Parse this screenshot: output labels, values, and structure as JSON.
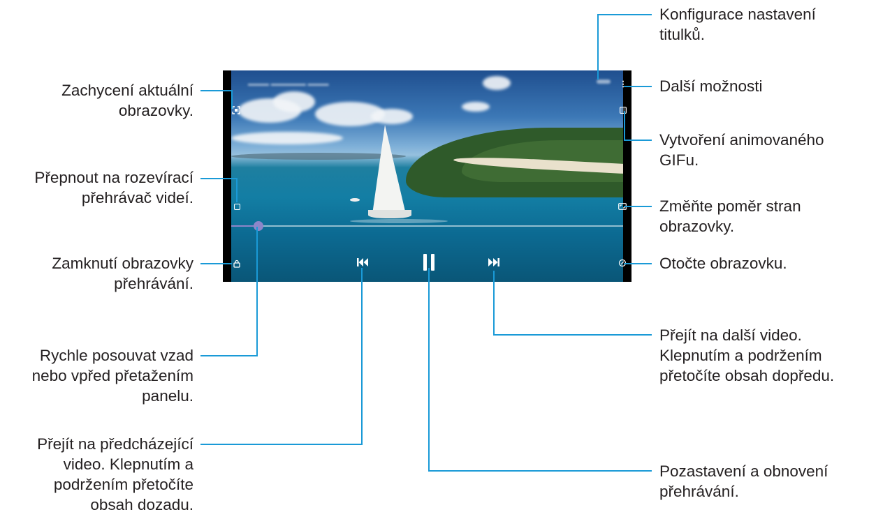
{
  "labels": {
    "subtitle_settings": [
      "Konfigurace nastavení",
      "titulků."
    ],
    "more_options": "Další možnosti",
    "create_gif": [
      "Vytvoření animovaného",
      "GIFu."
    ],
    "aspect_ratio": [
      "Změňte poměr stran",
      "obrazovky."
    ],
    "rotate": "Otočte obrazovku.",
    "next_video": [
      "Přejít na další video.",
      "Klepnutím a podržením",
      "přetočíte obsah dopředu."
    ],
    "pause_resume": [
      "Pozastavení a obnovení",
      "přehrávání."
    ],
    "capture": [
      "Zachycení aktuální",
      "obrazovky."
    ],
    "popup_player": [
      "Přepnout na rozevírací",
      "přehrávač videí."
    ],
    "lock": [
      "Zamknutí obrazovky",
      "přehrávání."
    ],
    "seek": [
      "Rychle posouvat vzad",
      "nebo vpřed přetažením",
      "panelu."
    ],
    "prev_video": [
      "Přejít na předcházející",
      "video. Klepnutím a",
      "podržením přetočíte",
      "obsah dozadu."
    ]
  },
  "player": {
    "progress": 0.07,
    "icons": {
      "capture": "capture-icon",
      "popup": "popup-player-icon",
      "lock": "lock-icon",
      "more": "more-options-icon",
      "gif": "gif-icon",
      "aspect": "aspect-ratio-icon",
      "rotate": "rotate-icon",
      "prev": "previous-icon",
      "pause": "pause-icon",
      "next": "next-icon"
    }
  },
  "colors": {
    "callout_line": "#1a9ad7",
    "progress": "#8d86c9"
  }
}
